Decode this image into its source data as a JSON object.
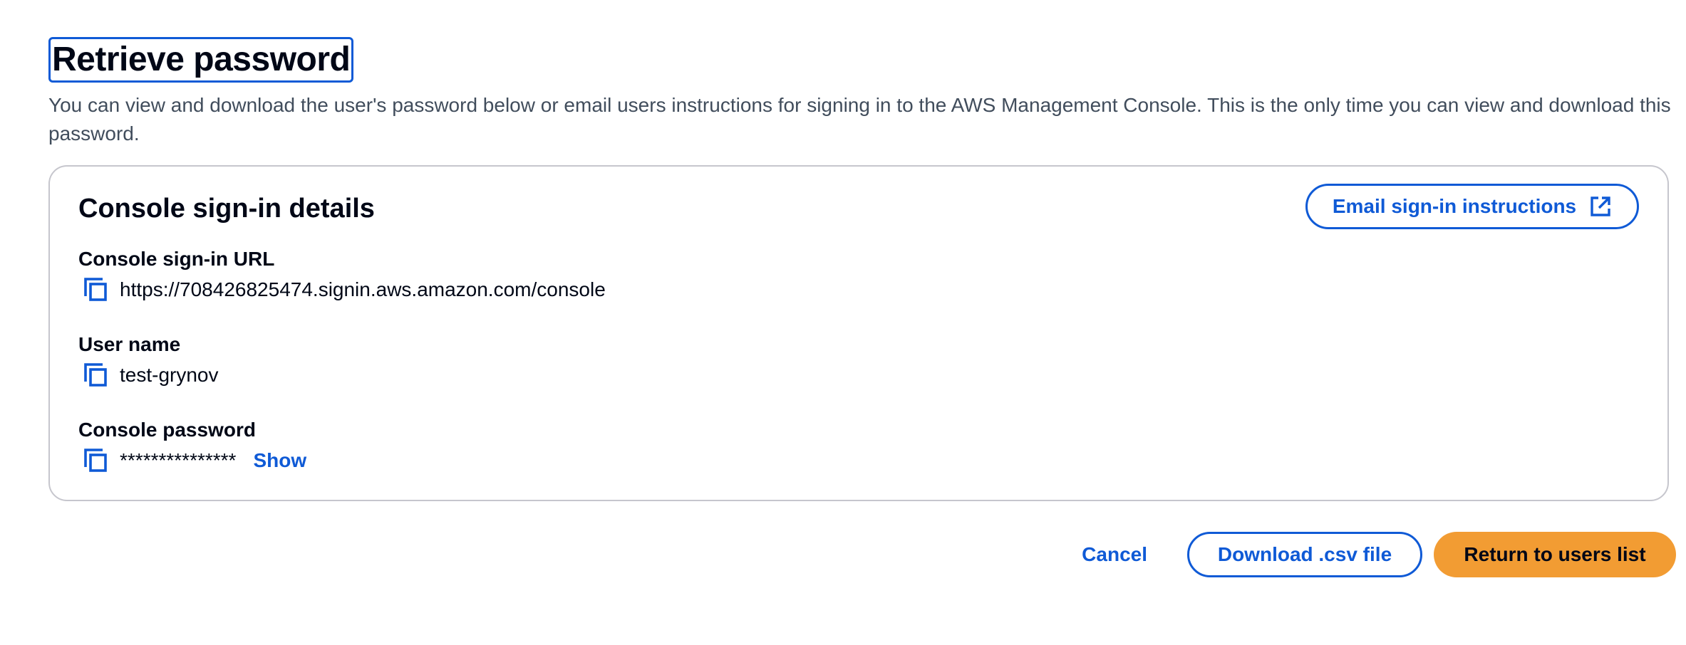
{
  "header": {
    "title": "Retrieve password",
    "description": "You can view and download the user's password below or email users instructions for signing in to the AWS Management Console. This is the only time you can view and download this password."
  },
  "card": {
    "title": "Console sign-in details",
    "email_button_label": "Email sign-in instructions",
    "email_button_icon": "external-link-icon",
    "fields": {
      "url": {
        "label": "Console sign-in URL",
        "value": "https://708426825474.signin.aws.amazon.com/console",
        "icon": "copy-icon"
      },
      "username": {
        "label": "User name",
        "value": "test-grynov",
        "icon": "copy-icon"
      },
      "password": {
        "label": "Console password",
        "value": "***************",
        "icon": "copy-icon",
        "show_label": "Show"
      }
    }
  },
  "actions": {
    "cancel_label": "Cancel",
    "download_label": "Download .csv file",
    "return_label": "Return to users list"
  },
  "colors": {
    "accent": "#0f5ad6",
    "primary_button": "#f29c33",
    "text": "#000716",
    "border": "#c6c6cd"
  }
}
